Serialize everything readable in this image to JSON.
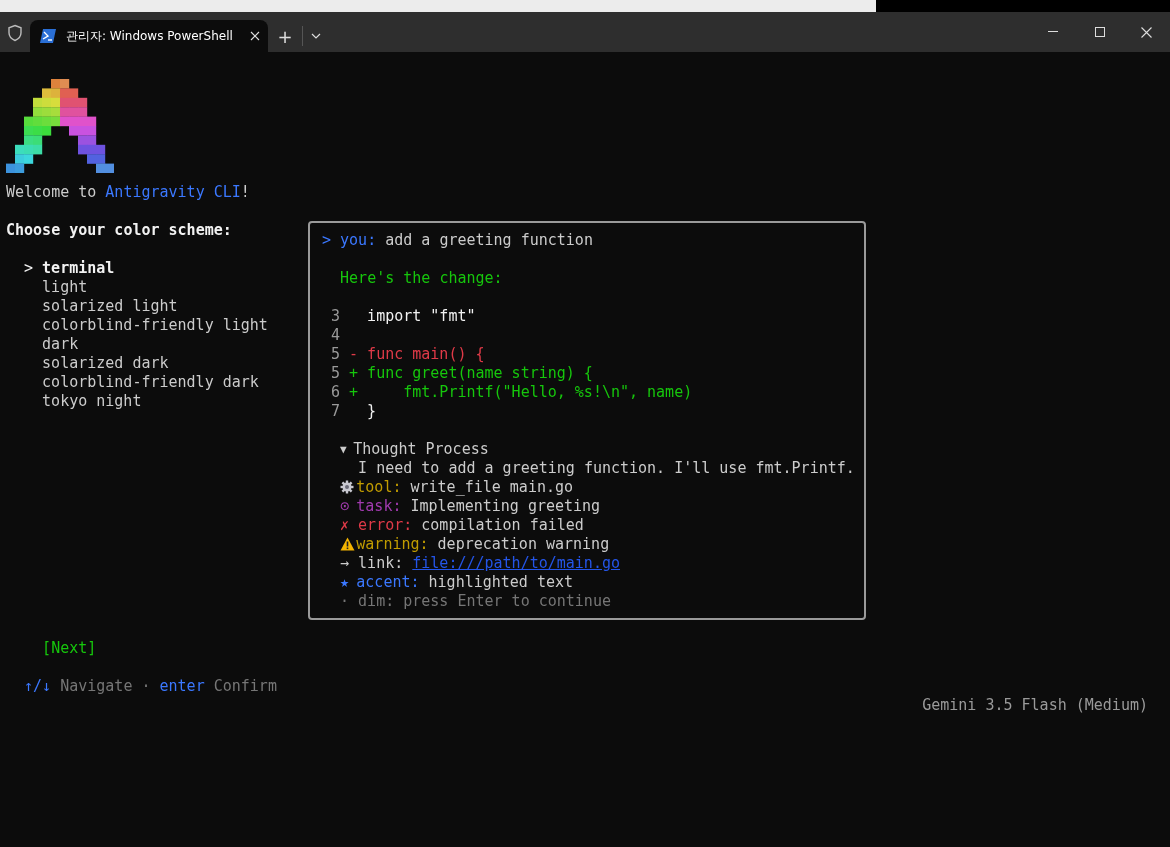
{
  "tabs": [
    {
      "title": "관리자: Windows PowerShell",
      "selected": true
    }
  ],
  "new_tab": "+",
  "welcome": {
    "before": "Welcome to ",
    "highlight": "Antigravity CLI",
    "after": "!"
  },
  "prompt": "Choose your color scheme:",
  "cursor": ">",
  "schemes": [
    {
      "label": "terminal",
      "selected": true
    },
    {
      "label": "light",
      "selected": false
    },
    {
      "label": "solarized light",
      "selected": false
    },
    {
      "label": "colorblind-friendly light",
      "selected": false
    },
    {
      "label": "dark",
      "selected": false
    },
    {
      "label": "solarized dark",
      "selected": false
    },
    {
      "label": "colorblind-friendly dark",
      "selected": false
    },
    {
      "label": "tokyo night",
      "selected": false
    }
  ],
  "chat": {
    "prompt_mark": ">",
    "speaker": "you:",
    "message": "add a greeting function",
    "intro": "Here's the change:",
    "diff": [
      {
        "line": "3",
        "kind": "context",
        "code": "import \"fmt\""
      },
      {
        "line": "4",
        "kind": "context"
      },
      {
        "line": "5",
        "kind": "removed",
        "sign": "-",
        "code": "func main() {"
      },
      {
        "line": "5",
        "kind": "added",
        "sign": "+",
        "code": "func greet(name string) {"
      },
      {
        "line": "6",
        "kind": "added",
        "sign": "+",
        "code": "    fmt.Printf(\"Hello, %s!\\n\", name)"
      },
      {
        "line": "7",
        "kind": "context",
        "code": "}"
      }
    ],
    "thought": {
      "expanded": true,
      "marker": "▼",
      "title": "Thought Process",
      "text": "I need to add a greeting function. I'll use fmt.Printf."
    },
    "events": [
      {
        "kind": "tool",
        "label": "tool:",
        "text": "write_file main.go"
      },
      {
        "kind": "task",
        "mark": "⊙",
        "label": "task:",
        "text": "Implementing greeting"
      },
      {
        "kind": "error",
        "mark": "✗",
        "label": "error:",
        "text": "compilation failed"
      },
      {
        "kind": "warning",
        "label": "warning:",
        "text": "deprecation warning"
      },
      {
        "kind": "link",
        "mark": "→",
        "label": "link:",
        "text": "file:///path/to/main.go"
      },
      {
        "kind": "accent",
        "mark": "★",
        "label": "accent:",
        "text": "highlighted text"
      },
      {
        "kind": "dim",
        "mark": "·",
        "label": "dim:",
        "text": "press Enter to continue"
      }
    ]
  },
  "next_button": "[Next]",
  "hints": [
    {
      "key": "↑/↓",
      "action": "Navigate"
    },
    {
      "key": "enter",
      "action": "Confirm"
    }
  ],
  "hint_separator": "·",
  "status": "Gemini 3.5 Flash (Medium)"
}
